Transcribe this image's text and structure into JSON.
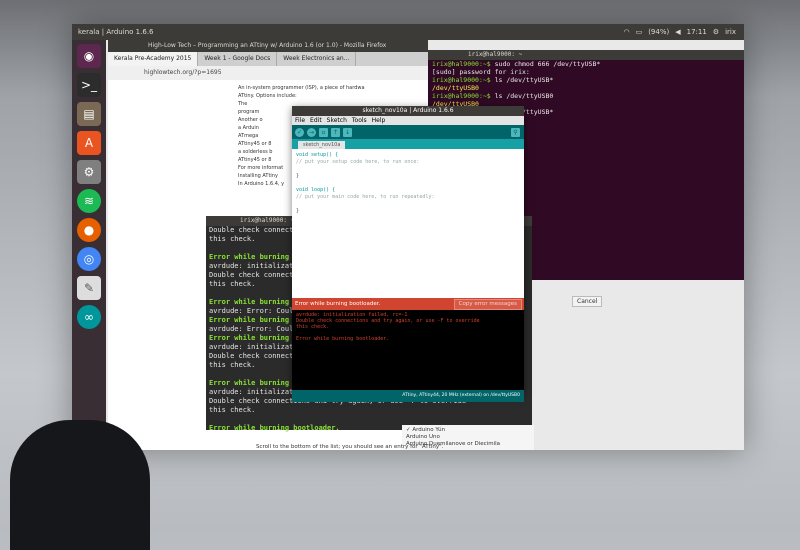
{
  "panel": {
    "title": "kerala | Arduino 1.6.6",
    "battery": "(94%)",
    "clock": "17:11",
    "user": "irix"
  },
  "firefox": {
    "window_title": "High-Low Tech – Programming an ATtiny w/ Arduino 1.6 (or 1.0) - Mozilla Firefox",
    "tabs": [
      "Kerala Pre-Academy 2015",
      "Week 1 - Google Docs",
      "Week Electronics an..."
    ],
    "url": "highlowtech.org/?p=1695",
    "body_lines": [
      "An in-system programmer (ISP), a piece of hardwa",
      "ATtiny. Options include:",
      "The",
      "program",
      "Another o",
      "a Arduin",
      "ATmega",
      "ATtiny45 or 8",
      "a solderless b",
      "ATtiny45 or 8",
      "For more informat",
      "Installing ATtiny",
      "In Arduino 1.6.4, y"
    ],
    "bottom_text": "Scroll to the bottom of the list; you should see an entry for \"ATtiny\"."
  },
  "terminal_right": {
    "title": "irix@hal9000: ~",
    "lines": [
      {
        "prompt": "irix@hal9000:~$",
        "cmd": " sudo chmod 666 /dev/ttyUSB*"
      },
      {
        "prompt": "",
        "cmd": "[sudo] password for irix:"
      },
      {
        "prompt": "irix@hal9000:~$",
        "cmd": " ls /dev/ttyUSB*"
      },
      {
        "prompt": "",
        "cmd": "/dev/ttyUSB0",
        "hl": true
      },
      {
        "prompt": "irix@hal9000:~$",
        "cmd": " ls /dev/ttyUSB0"
      },
      {
        "prompt": "",
        "cmd": "/dev/ttyUSB0",
        "hl": true
      },
      {
        "prompt": "irix@hal9000:~$",
        "cmd": " ls /dev/ttyUSB*"
      },
      {
        "prompt": "",
        "cmd": "/dev/ttyUSB0",
        "hl": true
      }
    ]
  },
  "terminal_left": {
    "title": "irix@hal9000: ~",
    "lines": [
      {
        "t": "        Double check connections and try again, or use -F to override",
        "c": ""
      },
      {
        "t": "        this check.",
        "c": ""
      },
      {
        "t": "",
        "c": ""
      },
      {
        "t": "Error while burning bootloader.",
        "c": "gb"
      },
      {
        "t": "avrdude: initialization failed, rc=-1",
        "c": ""
      },
      {
        "t": "        Double check connections and try again, or use -F to override",
        "c": ""
      },
      {
        "t": "        this check.",
        "c": ""
      },
      {
        "t": "",
        "c": ""
      },
      {
        "t": "Error while burning bootloader.",
        "c": "gb"
      },
      {
        "t": "avrdude: Error: Could not find USBtiny device (0x1781/0xc9f)",
        "c": ""
      },
      {
        "t": "Error while burning bootloader.",
        "c": "gb"
      },
      {
        "t": "avrdude: Error: Could not find USBtiny device (0x1781/0xc9f)",
        "c": ""
      },
      {
        "t": "Error while burning bootloader.",
        "c": "gb"
      },
      {
        "t": "avrdude: initialization failed, rc=-1",
        "c": ""
      },
      {
        "t": "        Double check connections and try again, or use -F to override",
        "c": ""
      },
      {
        "t": "        this check.",
        "c": ""
      },
      {
        "t": "",
        "c": ""
      },
      {
        "t": "Error while burning bootloader.",
        "c": "gb"
      },
      {
        "t": "avrdude: initialization failed, rc=-1",
        "c": ""
      },
      {
        "t": "        Double check connections and try again, or use -F to override",
        "c": ""
      },
      {
        "t": "        this check.",
        "c": ""
      },
      {
        "t": "",
        "c": ""
      },
      {
        "t": "Error while burning bootloader.",
        "c": "gb"
      }
    ]
  },
  "arduino": {
    "title": "sketch_nov10a | Arduino 1.6.6",
    "menu": [
      "File",
      "Edit",
      "Sketch",
      "Tools",
      "Help"
    ],
    "tab": "sketch_nov10a",
    "code": [
      {
        "t": "void setup() {",
        "c": "kw"
      },
      {
        "t": "  // put your setup code here, to run once:",
        "c": "cm"
      },
      {
        "t": "",
        "c": ""
      },
      {
        "t": "}",
        "c": ""
      },
      {
        "t": "",
        "c": ""
      },
      {
        "t": "void loop() {",
        "c": "kw"
      },
      {
        "t": "  // put your main code here, to run repeatedly:",
        "c": "cm"
      },
      {
        "t": "",
        "c": ""
      },
      {
        "t": "}",
        "c": ""
      }
    ],
    "error_bar": "Error while burning bootloader.",
    "copy_button": "Copy error messages",
    "console": [
      "avrdude: initialization failed, rc=-1",
      "         Double check connections and try again, or use -F to override",
      "         this check.",
      "",
      "Error while burning bootloader."
    ],
    "status": "ATtiny, ATtiny44, 20 MHz (external) on /dev/ttyUSB0"
  },
  "dialog": {
    "cancel": "Cancel"
  },
  "board_menu": {
    "items": [
      "✓ Arduino Yún",
      "Arduino Uno",
      "Arduino Duemilanove or Diecimila"
    ]
  },
  "launcher": {
    "icons": [
      "ubuntu-icon",
      "terminal-icon",
      "files-icon",
      "software-center-icon",
      "settings-icon",
      "spotify-icon",
      "firefox-icon",
      "chrome-icon",
      "text-editor-icon",
      "arduino-icon"
    ]
  }
}
